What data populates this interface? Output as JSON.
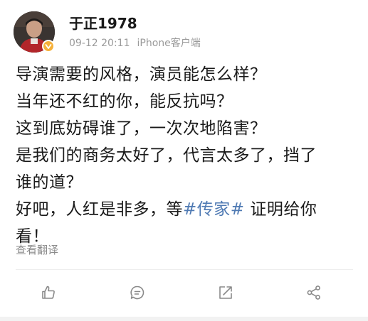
{
  "post": {
    "username": "于正1978",
    "timestamp": "09-12 20:11",
    "source": "iPhone客户端",
    "verified_badge_color": "#f6b13a",
    "lines": [
      "导演需要的风格，演员能怎么样？",
      "当年还不红的你，能反抗吗？",
      "这到底妨碍谁了，一次次地陷害？",
      "是我们的商务太好了，代言太多了，挡了",
      "谁的道？"
    ],
    "last_line_prefix": "好吧，人红是非多，等",
    "topic": "#传家#",
    "last_line_suffix": " 证明给你",
    "final_line": "看！",
    "topic_color": "#4f7ab3",
    "translate_label": "查看翻译"
  },
  "actions": [
    {
      "name": "like",
      "icon": "thumbs-up-icon"
    },
    {
      "name": "comment",
      "icon": "comment-icon"
    },
    {
      "name": "repost",
      "icon": "repost-icon"
    },
    {
      "name": "share",
      "icon": "share-icon"
    }
  ]
}
